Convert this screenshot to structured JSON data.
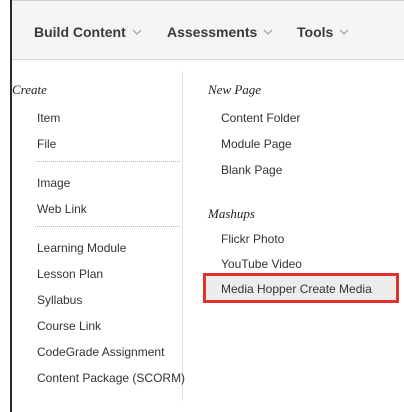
{
  "toolbar": {
    "build_content": "Build Content",
    "assessments": "Assessments",
    "tools": "Tools"
  },
  "menu": {
    "create_heading": "Create",
    "create_items": [
      "Item",
      "File",
      "Image",
      "Web Link",
      "Learning Module",
      "Lesson Plan",
      "Syllabus",
      "Course Link",
      "CodeGrade Assignment",
      "Content Package (SCORM)"
    ],
    "new_page_heading": "New Page",
    "new_page_items": [
      "Content Folder",
      "Module Page",
      "Blank Page"
    ],
    "mashups_heading": "Mashups",
    "mashups_items": [
      "Flickr Photo",
      "YouTube Video",
      "Media Hopper Create Media"
    ]
  },
  "icons": {
    "chevron": "chevron-down-icon"
  },
  "colors": {
    "highlight_border": "#e0322a",
    "highlight_fill": "#ececec"
  }
}
